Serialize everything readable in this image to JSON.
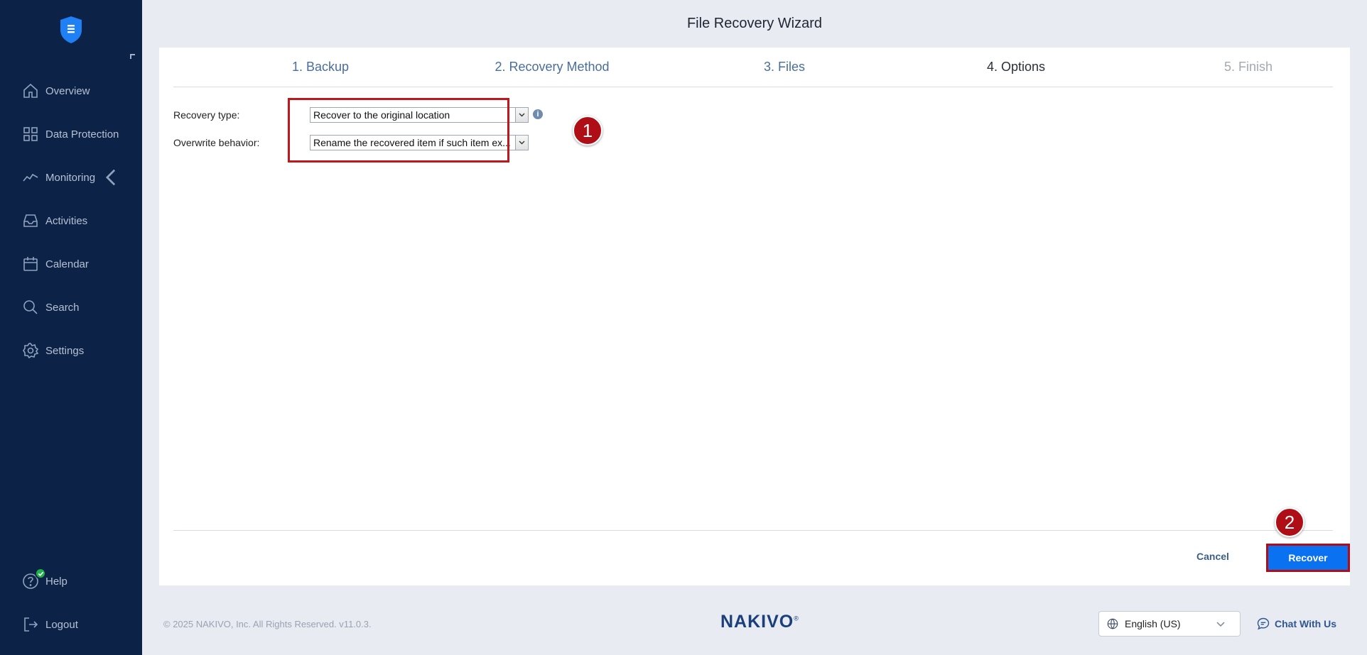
{
  "sidebar": {
    "items": [
      {
        "label": "Overview",
        "icon": "home-icon"
      },
      {
        "label": "Data Protection",
        "icon": "grid-icon"
      },
      {
        "label": "Monitoring",
        "icon": "activity-icon"
      },
      {
        "label": "Activities",
        "icon": "inbox-icon"
      },
      {
        "label": "Calendar",
        "icon": "calendar-icon"
      },
      {
        "label": "Search",
        "icon": "search-icon"
      },
      {
        "label": "Settings",
        "icon": "gear-icon"
      }
    ],
    "help": "Help",
    "logout": "Logout"
  },
  "wizard": {
    "title": "File Recovery Wizard",
    "steps": [
      "1. Backup",
      "2. Recovery Method",
      "3. Files",
      "4. Options",
      "5. Finish"
    ],
    "active_step": 4
  },
  "options": {
    "recovery_type_label": "Recovery type:",
    "recovery_type_value": "Recover to the original location",
    "overwrite_label": "Overwrite behavior:",
    "overwrite_value": "Rename the recovered item if such item ex..."
  },
  "annotations": {
    "badge1": "1",
    "badge2": "2"
  },
  "actions": {
    "cancel": "Cancel",
    "recover": "Recover"
  },
  "footer": {
    "copyright": "© 2025 NAKIVO, Inc. All Rights Reserved. v11.0.3.",
    "brand": "NAKIVO",
    "brand_mark": "®",
    "language": "English (US)",
    "chat": "Chat With Us"
  },
  "colors": {
    "sidebar_bg": "#0d2247",
    "accent": "#0a72f0",
    "highlight": "#c0171c"
  }
}
